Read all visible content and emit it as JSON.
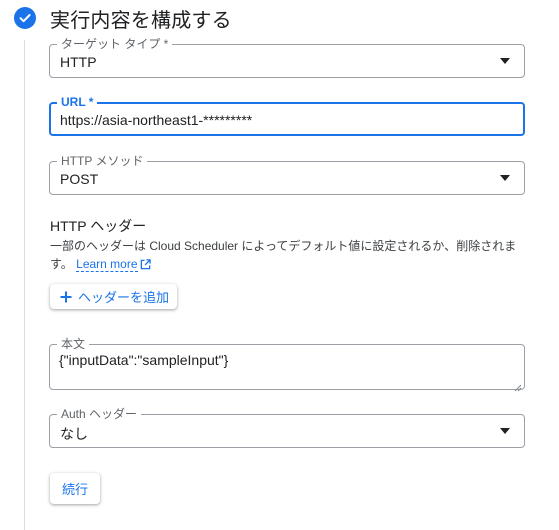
{
  "step": {
    "title": "実行内容を構成する"
  },
  "target_type": {
    "label": "ターゲット タイプ *",
    "value": "HTTP"
  },
  "url": {
    "label": "URL *",
    "value": "https://asia-northeast1-*********"
  },
  "http_method": {
    "label": "HTTP メソッド",
    "value": "POST"
  },
  "http_headers": {
    "title": "HTTP ヘッダー",
    "description": "一部のヘッダーは Cloud Scheduler によってデフォルト値に設定されるか、削除されます。",
    "learn_more": "Learn more",
    "add_button": "ヘッダーを追加"
  },
  "body": {
    "label": "本文",
    "value": "{\"inputData\":\"sampleInput\"}"
  },
  "auth_header": {
    "label": "Auth ヘッダー",
    "value": "なし"
  },
  "continue_button": "続行",
  "colors": {
    "accent": "#1a73e8",
    "border": "#9aa0a6",
    "text": "#202124",
    "muted": "#5f6368"
  },
  "icons": [
    "check-circle-icon",
    "dropdown-arrow-icon",
    "external-link-icon",
    "plus-icon",
    "resize-grip-icon"
  ]
}
